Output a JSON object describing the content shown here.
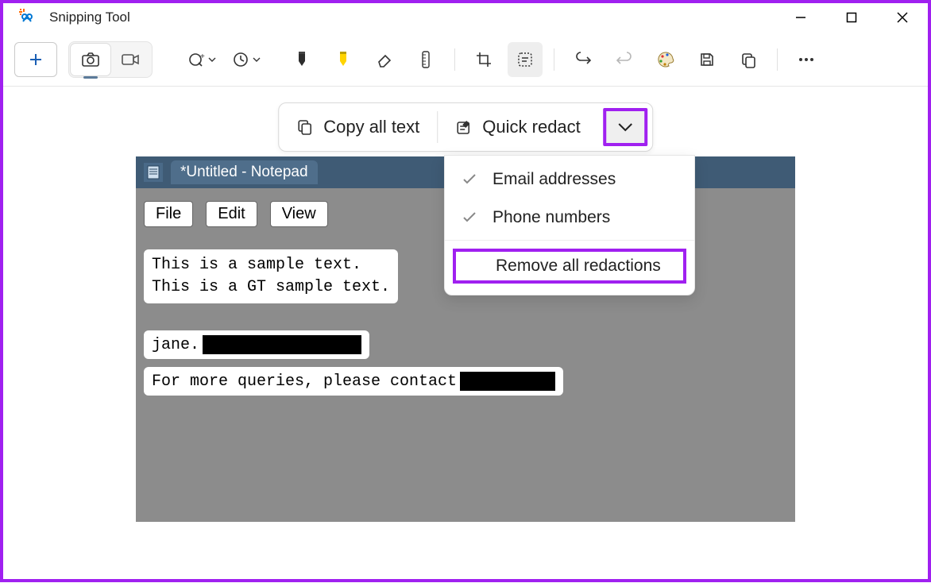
{
  "window": {
    "title": "Snipping Tool"
  },
  "actionbar": {
    "copy_all": "Copy all text",
    "quick_redact": "Quick redact"
  },
  "dropdown": {
    "email": "Email addresses",
    "phone": "Phone numbers",
    "remove": "Remove all redactions"
  },
  "notepad": {
    "tab_title": "*Untitled - Notepad",
    "menus": {
      "file": "File",
      "edit": "Edit",
      "view": "View"
    },
    "body": {
      "line1": "This is a sample text.",
      "line2": "This is a GT sample text.",
      "line3_prefix": "jane.",
      "line4_prefix": "For more queries, please contact "
    }
  }
}
